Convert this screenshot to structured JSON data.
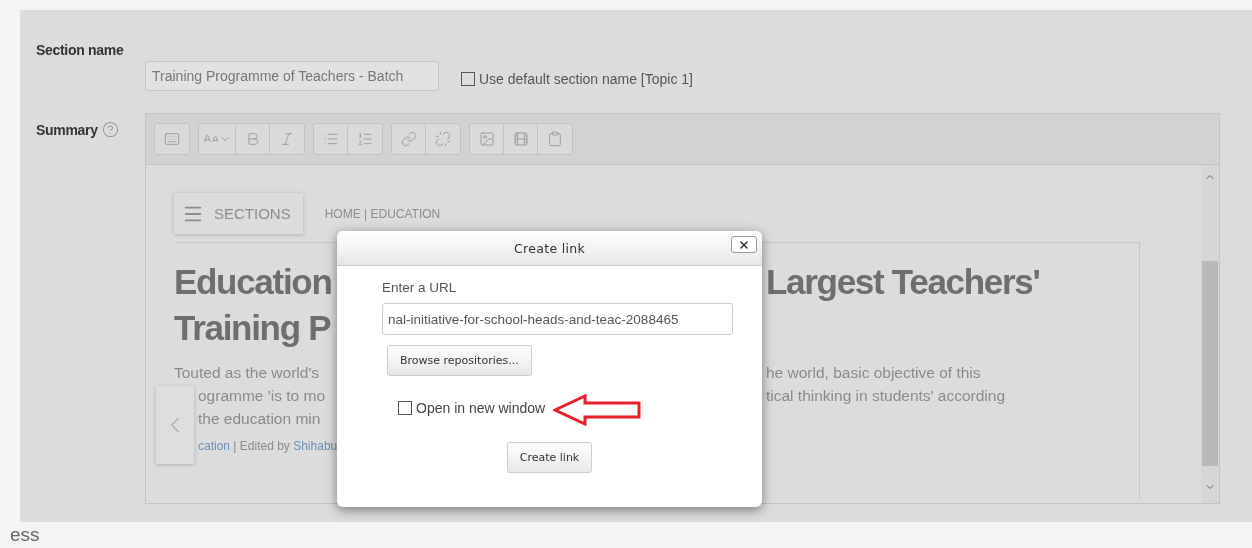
{
  "section_name": {
    "label": "Section name",
    "value": "Training Programme of Teachers - Batch",
    "default_option": {
      "label": "Use default section name [Topic 1]",
      "checked": false
    }
  },
  "summary": {
    "label": "Summary"
  },
  "editor_content": {
    "menu_button": "SECTIONS",
    "breadcrumb": "HOME | EDUCATION",
    "heading_lines": [
      {
        "left": "Education",
        "right": "Largest Teachers'"
      },
      {
        "left": "Training P"
      }
    ],
    "body_lines": [
      {
        "left": "Touted as the world's",
        "right": "he world, basic objective of this"
      },
      {
        "left": "ogramme 'is to mo",
        "right": "tical thinking in students' according"
      },
      {
        "left": "the education min"
      }
    ],
    "byline": {
      "category": "cation",
      "middle": " | Edited by ",
      "author": "Shihabu"
    }
  },
  "dialog": {
    "title": "Create link",
    "url_label": "Enter a URL",
    "url_value": "nal-initiative-for-school-heads-and-teac-2088465",
    "browse_button": "Browse repositories...",
    "new_window": {
      "label": "Open in new window",
      "checked": false
    },
    "submit_button": "Create link"
  },
  "footer_text": "ess"
}
